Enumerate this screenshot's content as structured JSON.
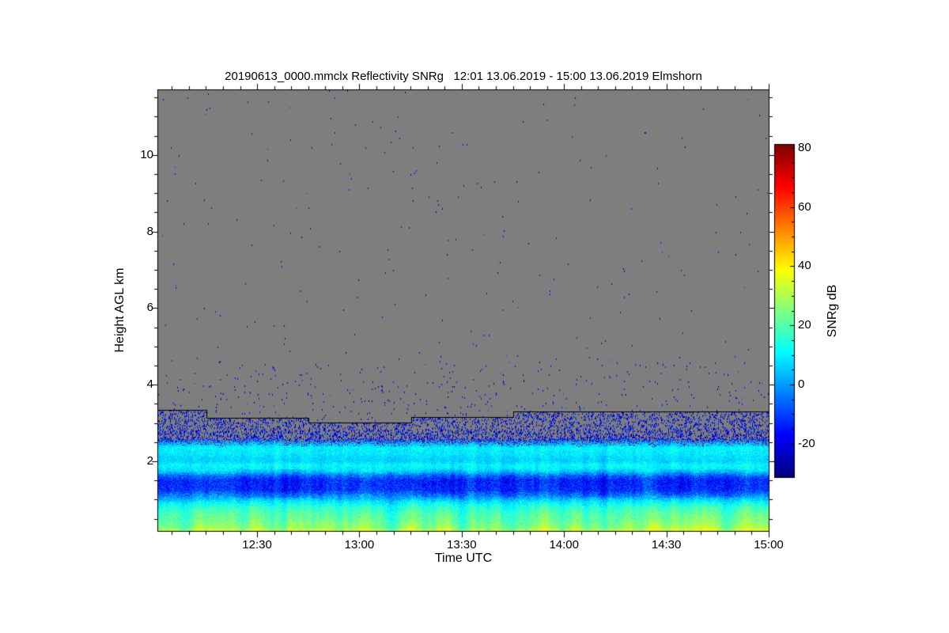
{
  "chart_data": {
    "type": "heatmap",
    "title": "20190613_0000.mmclx Reflectivity SNRg   12:01 13.06.2019 - 15:00 13.06.2019 Elmshorn",
    "file": "20190613_0000.mmclx",
    "quantity": "Reflectivity SNRg",
    "time_start": "12:01 13.06.2019",
    "time_end": "15:00 13.06.2019",
    "station": "Elmshorn",
    "xlabel": "Time UTC",
    "ylabel": "Height AGL km",
    "colorbar_label": "SNRg dB",
    "x_axis": {
      "start": "12:01",
      "end": "15:00",
      "total_minutes": 179,
      "major_ticks": [
        {
          "label": "12:30",
          "minutes": 29
        },
        {
          "label": "13:00",
          "minutes": 59
        },
        {
          "label": "13:30",
          "minutes": 89
        },
        {
          "label": "14:00",
          "minutes": 119
        },
        {
          "label": "14:30",
          "minutes": 149
        },
        {
          "label": "15:00",
          "minutes": 179
        }
      ],
      "minor_tick_every_minutes": 5
    },
    "y_axis": {
      "range_km": [
        0.18,
        11.71
      ],
      "major_ticks_km": [
        2,
        4,
        6,
        8,
        10
      ],
      "minor_tick_every_km": 0.5
    },
    "colorbar": {
      "colormap": "jet",
      "range_db": [
        -31,
        81
      ],
      "major_ticks_db": [
        80,
        60,
        40,
        20,
        0,
        -20
      ],
      "minor_tick_every_db": 5
    },
    "nodata_color": "#7e7e7e",
    "boundary_line_km": [
      {
        "start_min": 0,
        "end_min": 14,
        "height_km": 3.34
      },
      {
        "start_min": 14,
        "end_min": 44,
        "height_km": 3.14
      },
      {
        "start_min": 44,
        "end_min": 74,
        "height_km": 3.01
      },
      {
        "start_min": 74,
        "end_min": 104,
        "height_km": 3.16
      },
      {
        "start_min": 104,
        "end_min": 179,
        "height_km": 3.3
      }
    ],
    "noise_dots": {
      "base_density": 0.0007,
      "ramp_below_km": 5.0,
      "ramp_density": 0.0085,
      "band_km": [
        4.25,
        4.55
      ],
      "band_extra_density": 0.003,
      "dot_db_range": [
        -28,
        -14
      ]
    },
    "speckle_band": {
      "top": "boundary_line",
      "bottom_km": 2.58,
      "density": 0.14,
      "db_range": [
        -28,
        -10
      ]
    },
    "signal_profile_km_db": [
      [
        0.18,
        33
      ],
      [
        0.26,
        27
      ],
      [
        0.42,
        23
      ],
      [
        0.62,
        20
      ],
      [
        0.82,
        15
      ],
      [
        0.95,
        8
      ],
      [
        1.08,
        -2
      ],
      [
        1.25,
        -12
      ],
      [
        1.5,
        -13
      ],
      [
        1.62,
        -6
      ],
      [
        1.72,
        4
      ],
      [
        1.8,
        9
      ],
      [
        1.9,
        11
      ],
      [
        2.0,
        6
      ],
      [
        2.1,
        7
      ],
      [
        2.2,
        9
      ],
      [
        2.35,
        10
      ],
      [
        2.5,
        2
      ],
      [
        2.62,
        -12
      ],
      [
        2.75,
        -18
      ]
    ]
  }
}
